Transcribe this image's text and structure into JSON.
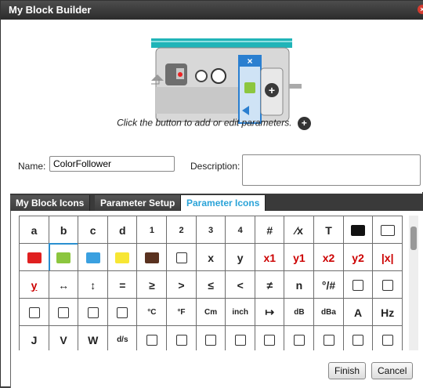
{
  "window": {
    "title": "My Block Builder",
    "close_glyph": "×"
  },
  "builder": {
    "remove_glyph": "×",
    "add_glyph": "+",
    "hint": "Click the button to add or edit parameters."
  },
  "form": {
    "name_label": "Name:",
    "name_value": "ColorFollower",
    "description_label": "Description:",
    "description_value": ""
  },
  "tabs": [
    {
      "label": "My Block Icons",
      "active": false
    },
    {
      "label": "Parameter Setup",
      "active": false
    },
    {
      "label": "Parameter Icons",
      "active": true
    }
  ],
  "icons": {
    "row1": [
      "a",
      "b",
      "c",
      "d",
      "1",
      "2",
      "3",
      "4",
      "#",
      "⁄x",
      "T",
      "black-square-icon",
      "white-square-icon"
    ],
    "row2": [
      "red-swatch-icon",
      "green-swatch-icon",
      "blue-swatch-icon",
      "yellow-swatch-icon",
      "brown-swatch-icon",
      "no-color-icon",
      "x",
      "y",
      "x1",
      "y1",
      "x2",
      "y2",
      "|x|"
    ],
    "row3": [
      "y",
      "↔",
      "↕",
      "=",
      "≥",
      ">",
      "≤",
      "<",
      "≠",
      "n",
      "°/#",
      "down-hash-icon",
      "hash-arrow-icon"
    ],
    "row4": [
      "width-icon",
      "hash-in-icon",
      "small-hash-icon",
      "hash-out-icon",
      "°C",
      "°F",
      "Cm",
      "inch",
      "↦",
      "dB",
      "dBa",
      "A",
      "Hz"
    ],
    "row5": [
      "J",
      "V",
      "W",
      "d/s",
      "rotate-icon",
      "eraser-icon",
      "half-circle-icon",
      "slash-icon",
      "slash-dark-icon",
      "frame-icon",
      "frame-dark-icon",
      "ring-icon",
      "ring-dark-icon"
    ]
  },
  "swatch_colors": {
    "red": "#e02020",
    "green": "#8cc63f",
    "blue": "#3aa0e0",
    "yellow": "#f7e634",
    "brown": "#5a3220"
  },
  "buttons": {
    "finish": "Finish",
    "cancel": "Cancel"
  }
}
